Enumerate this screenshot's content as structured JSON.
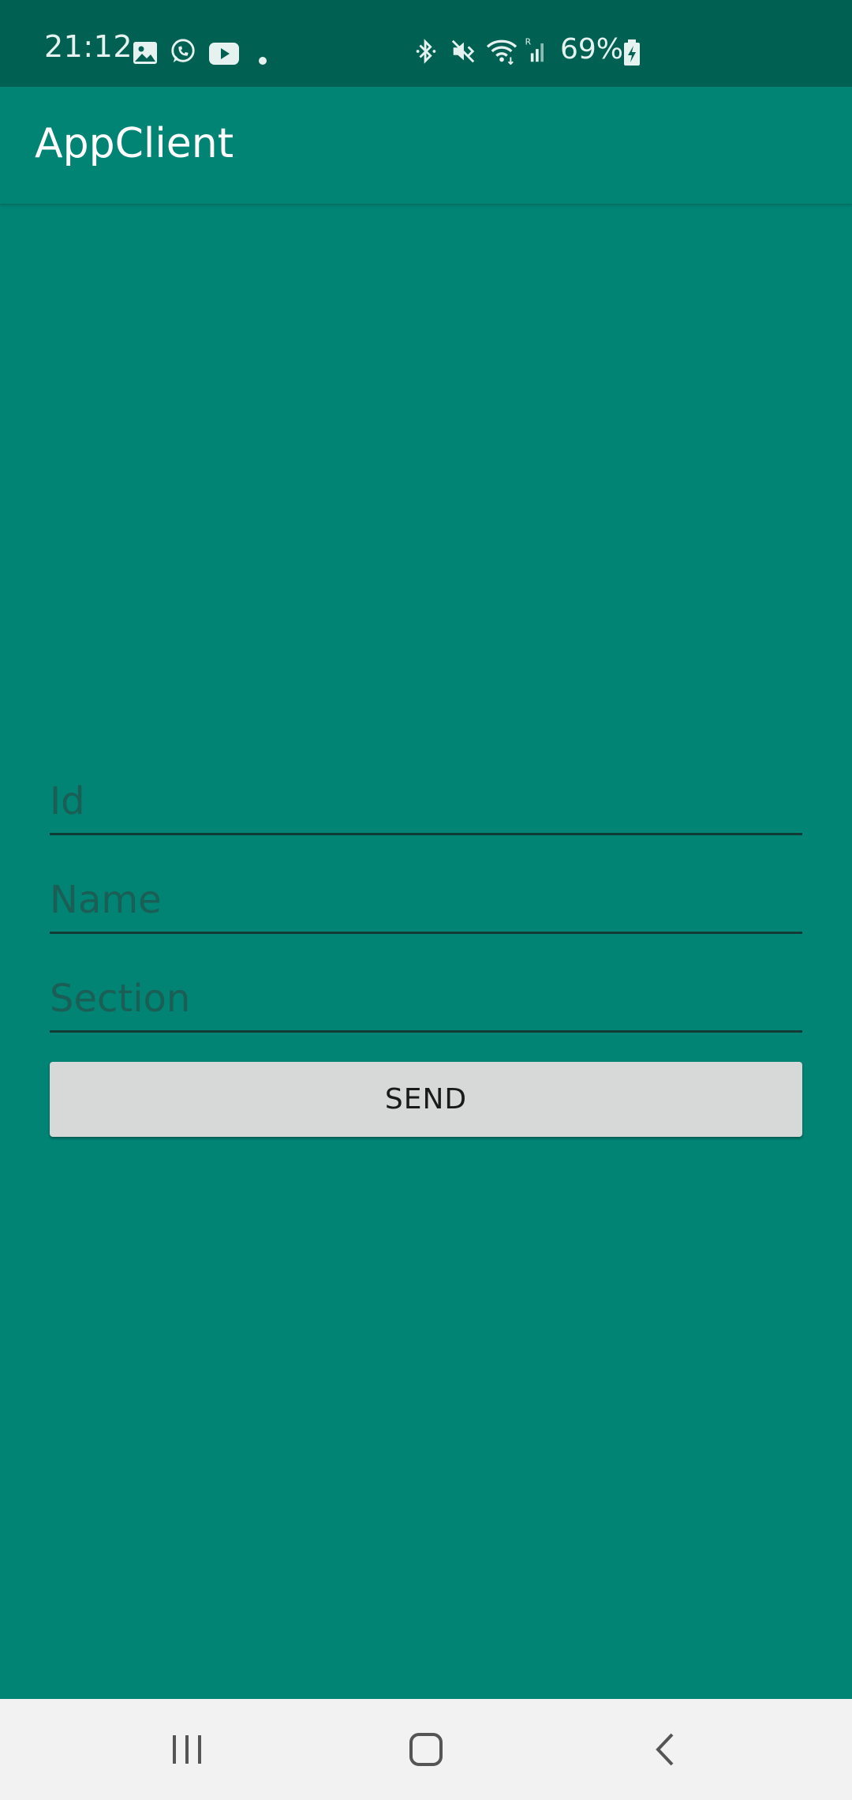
{
  "status_bar": {
    "time": "21:12",
    "battery": "69%",
    "icons": [
      "image-icon",
      "whatsapp-icon",
      "youtube-icon",
      "dot-icon",
      "bluetooth-icon",
      "mute-icon",
      "wifi-icon",
      "signal-icon",
      "battery-charging-icon"
    ]
  },
  "app_bar": {
    "title": "AppClient"
  },
  "form": {
    "id_placeholder": "Id",
    "name_placeholder": "Name",
    "section_placeholder": "Section",
    "send_label": "SEND"
  },
  "nav_bar": {
    "icons": [
      "recents-icon",
      "home-icon",
      "back-icon"
    ]
  },
  "colors": {
    "background": "#028475",
    "status_bar": "#006153",
    "button": "#d7d8d8",
    "nav_bar": "#f2f2f2"
  }
}
